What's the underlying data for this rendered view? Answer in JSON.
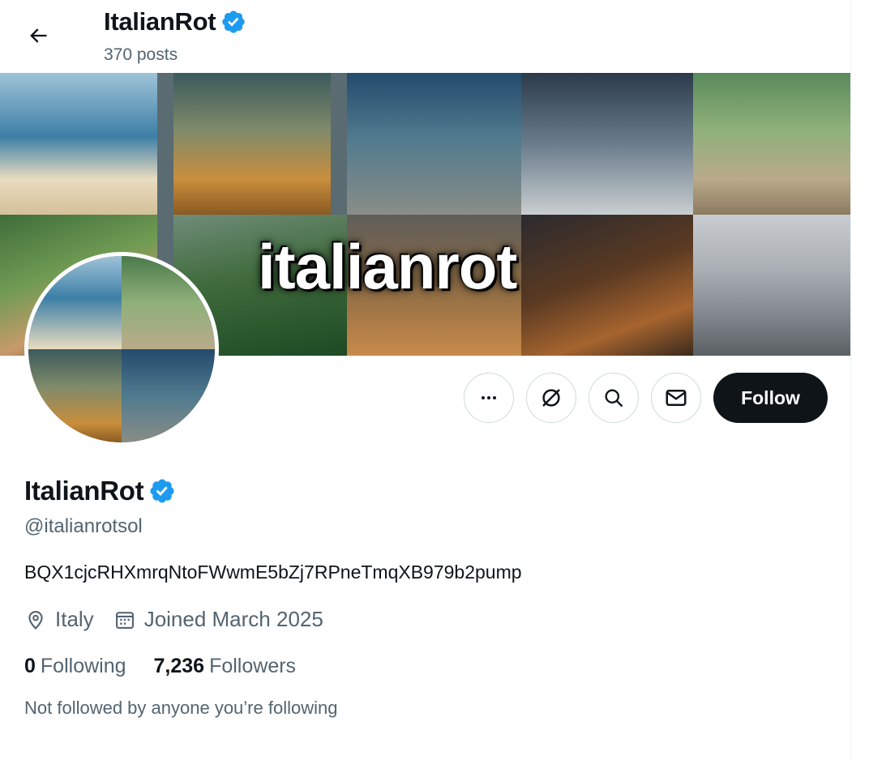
{
  "header": {
    "name": "ItalianRot",
    "posts": "370 posts"
  },
  "banner": {
    "title_text": "italianrot"
  },
  "profile": {
    "name": "ItalianRot",
    "handle": "@italianrotsol",
    "bio": "BQX1cjcRHXmrqNtoFWwmE5bZj7RPneTmqXB979b2pump",
    "location": "Italy",
    "joined": "Joined March 2025",
    "following_count": "0",
    "following_label": "Following",
    "followers_count": "7,236",
    "followers_label": "Followers",
    "not_followed_note": "Not followed by anyone you’re following"
  },
  "actions": {
    "follow_label": "Follow"
  },
  "icons": [
    "back-arrow-icon",
    "verified-badge-icon",
    "more-icon",
    "subscribe-icon",
    "search-icon",
    "message-icon",
    "location-icon",
    "calendar-icon"
  ],
  "colors": {
    "verified": "#1d9bf0",
    "follow_bg": "#0f1419",
    "secondary_text": "#536471"
  }
}
